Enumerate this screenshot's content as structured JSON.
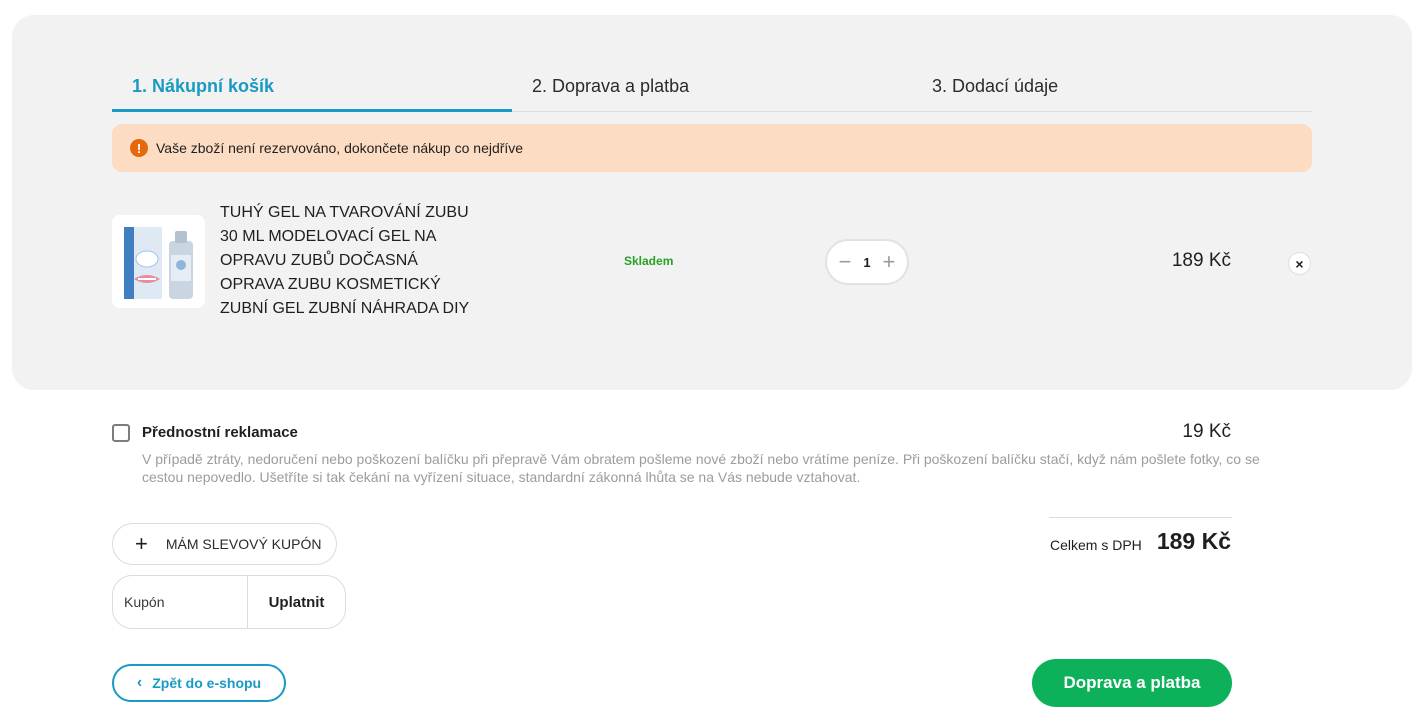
{
  "steps": [
    {
      "label": "1. Nákupní košík",
      "active": true
    },
    {
      "label": "2. Doprava a platba",
      "active": false
    },
    {
      "label": "3. Dodací údaje",
      "active": false
    }
  ],
  "alert": {
    "icon": "exclamation-icon",
    "text": "Vaše zboží není rezervováno, dokončete nákup co nejdříve"
  },
  "cart_item": {
    "name": "TUHÝ GEL NA TVAROVÁNÍ ZUBU 30 ML MODELOVACÍ GEL NA OPRAVU ZUBŮ DOČASNÁ OPRAVA ZUBU KOSMETICKÝ ZUBNÍ GEL ZUBNÍ NÁHRADA DIY",
    "stock": "Skladem",
    "quantity": "1",
    "minus": "−",
    "plus": "+",
    "price": "189 Kč",
    "remove": "×"
  },
  "priority_claim": {
    "title": "Přednostní reklamace",
    "price": "19 Kč",
    "description": "V případě ztráty, nedoručení nebo poškození balíčku při přepravě Vám obratem pošleme nové zboží nebo vrátíme peníze. Při poškození balíčku stačí, když nám pošlete fotky, co se cestou nepovedlo. Ušetříte si tak čekání na vyřízení situace, standardní zákonná lhůta se na Vás nebude vztahovat.",
    "checked": false
  },
  "coupon": {
    "toggle_icon": "+",
    "toggle_label": "MÁM SLEVOVÝ KUPÓN",
    "placeholder": "Kupón",
    "apply_label": "Uplatnit"
  },
  "total": {
    "label": "Celkem s DPH",
    "value": "189 Kč"
  },
  "nav": {
    "back_icon": "‹",
    "back_label": "Zpět do e-shopu",
    "next_label": "Doprava a platba"
  },
  "colors": {
    "accent": "#1a9ac3",
    "alert_bg": "#fddcc4",
    "alert_icon": "#e5690c",
    "stock": "#2aa125",
    "primary_button": "#0db15a",
    "panel_bg": "#f2f2f2"
  }
}
